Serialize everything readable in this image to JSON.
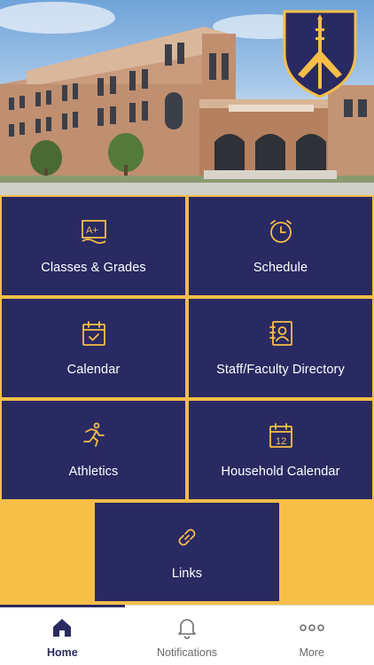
{
  "tiles": [
    {
      "label": "Classes & Grades",
      "icon": "grade-paper-icon"
    },
    {
      "label": "Schedule",
      "icon": "alarm-clock-icon"
    },
    {
      "label": "Calendar",
      "icon": "calendar-check-icon"
    },
    {
      "label": "Staff/Faculty Directory",
      "icon": "contact-book-icon"
    },
    {
      "label": "Athletics",
      "icon": "runner-icon"
    },
    {
      "label": "Household Calendar",
      "icon": "calendar-12-icon"
    },
    {
      "label": "Links",
      "icon": "link-icon"
    }
  ],
  "icon_texts": {
    "grade": "A+",
    "calendar_day": "12"
  },
  "tabs": [
    {
      "label": "Home",
      "icon": "home-icon",
      "active": true
    },
    {
      "label": "Notifications",
      "icon": "bell-icon",
      "active": false
    },
    {
      "label": "More",
      "icon": "more-dots-icon",
      "active": false
    }
  ],
  "colors": {
    "navy": "#2a2a62",
    "gold": "#f7be48",
    "tab_text": "#6b6b6b",
    "white": "#ffffff"
  }
}
